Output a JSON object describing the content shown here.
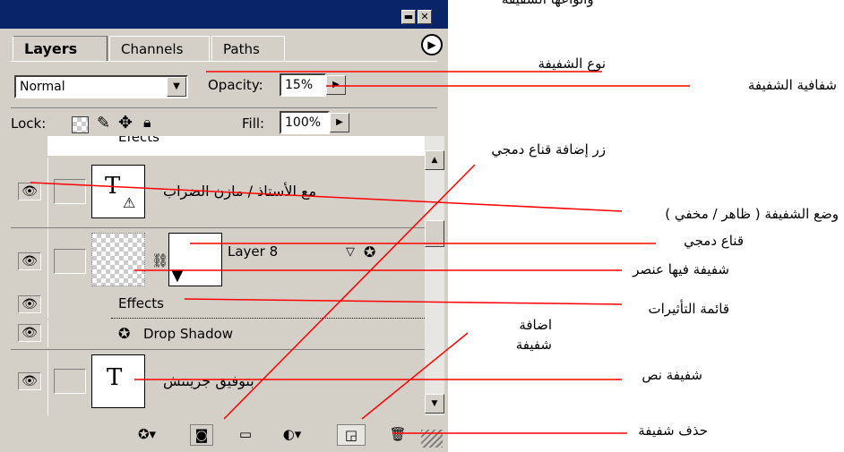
{
  "title_fragment": "وأنواعها الشفيفة",
  "panel": {
    "tabs": [
      "Layers",
      "Channels",
      "Paths"
    ],
    "blend_mode": "Normal",
    "opacity_label": "Opacity:",
    "opacity_value": "15%",
    "lock_label": "Lock:",
    "fill_label": "Fill:",
    "fill_value": "100%"
  },
  "layers": {
    "partial_top": "Efects",
    "text_layer_1": "مع الأستاذ / مازن الضراب",
    "layer8_name": "Layer 8",
    "effects_label": "Effects",
    "drop_shadow_label": "Drop Shadow",
    "text_layer_2": "بتوفيق جرينتش",
    "text_thumb_glyph": "T"
  },
  "annotations": {
    "blend_type": "نوع الشفيفة",
    "opacity": "شفافية الشفيفة",
    "add_mask_button": "زر إضافة قناع دمجي",
    "visibility": "وضع الشفيفة ( ظاهر / مخفي )",
    "layer_mask": "قناع دمجي",
    "layer_with_element": "شفيفة فيها عنصر",
    "effects_list": "قائمة التأثيرات",
    "add_layer_line1": "اضافة",
    "add_layer_line2": "شفيفة",
    "text_layer": "شفيفة نص",
    "delete_layer": "حذف شفيفة"
  },
  "colors": {
    "panel_bg": "#d4d0c8",
    "title_bar": "#0a246a",
    "callout_line": "#ff0000"
  },
  "icons": [
    "eye-icon",
    "chain-link-icon",
    "effects-icon",
    "mask-icon",
    "folder-icon",
    "adjustment-icon",
    "new-layer-icon",
    "trash-icon",
    "lock-transparency-icon",
    "lock-brush-icon",
    "lock-move-icon",
    "lock-all-icon"
  ]
}
